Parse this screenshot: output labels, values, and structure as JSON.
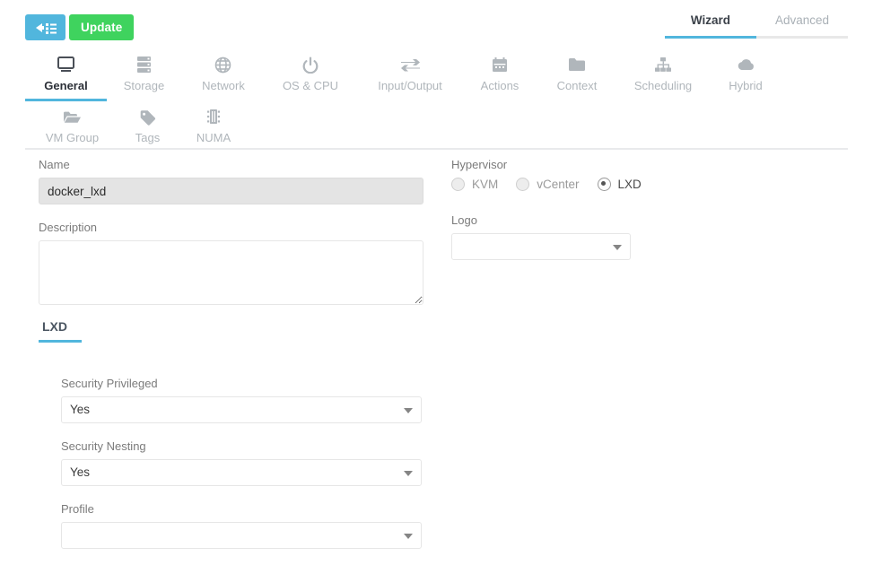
{
  "toolbar": {
    "back_label": "back-to-list",
    "back_icon": "arrow-left-list-icon",
    "update_label": "Update"
  },
  "mode_tabs": [
    {
      "label": "Wizard",
      "active": true
    },
    {
      "label": "Advanced",
      "active": false
    }
  ],
  "main_tabs": [
    {
      "label": "General",
      "icon": "monitor-icon",
      "active": true
    },
    {
      "label": "Storage",
      "icon": "server-stack-icon",
      "active": false
    },
    {
      "label": "Network",
      "icon": "globe-icon",
      "active": false
    },
    {
      "label": "OS & CPU",
      "icon": "power-icon",
      "active": false
    },
    {
      "label": "Input/Output",
      "icon": "exchange-icon",
      "active": false
    },
    {
      "label": "Actions",
      "icon": "calendar-icon",
      "active": false
    },
    {
      "label": "Context",
      "icon": "folder-icon",
      "active": false
    },
    {
      "label": "Scheduling",
      "icon": "sitemap-icon",
      "active": false
    },
    {
      "label": "Hybrid",
      "icon": "cloud-icon",
      "active": false
    }
  ],
  "sub_tabs": [
    {
      "label": "VM Group",
      "icon": "folder-open-icon",
      "active": false
    },
    {
      "label": "Tags",
      "icon": "tag-icon",
      "active": false
    },
    {
      "label": "NUMA",
      "icon": "memory-chip-icon",
      "active": false
    }
  ],
  "form": {
    "name": {
      "label": "Name",
      "value": "docker_lxd",
      "placeholder": ""
    },
    "description": {
      "label": "Description",
      "value": "",
      "placeholder": ""
    },
    "hypervisor": {
      "label": "Hypervisor",
      "options": [
        {
          "label": "KVM",
          "checked": false
        },
        {
          "label": "vCenter",
          "checked": false
        },
        {
          "label": "LXD",
          "checked": true
        }
      ]
    },
    "logo": {
      "label": "Logo",
      "value": ""
    }
  },
  "lxd_section": {
    "tab_label": "LXD",
    "fields": [
      {
        "label": "Security Privileged",
        "value": "Yes"
      },
      {
        "label": "Security Nesting",
        "value": "Yes"
      },
      {
        "label": "Profile",
        "value": ""
      }
    ]
  },
  "colors": {
    "accent_blue": "#51b6dd",
    "success_green": "#3fd35e",
    "label_gray": "#7b7b7b",
    "inactive_gray": "#b0b6bb",
    "divider": "#e9eaec"
  }
}
